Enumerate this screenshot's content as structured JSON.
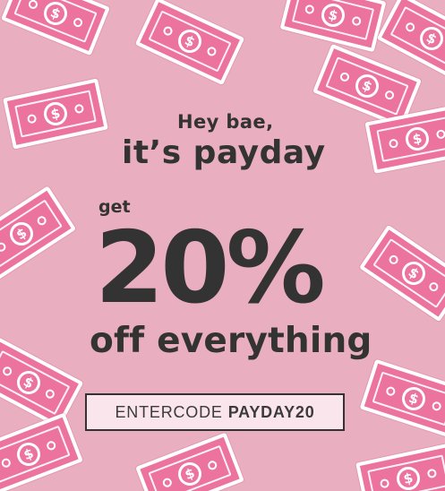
{
  "promo": {
    "line1": "Hey bae,",
    "line2": "it’s payday",
    "line3": "get",
    "discount": "20%",
    "line5": "off everything",
    "code_prefix": "ENTERCODE",
    "code": "PAYDAY20"
  },
  "bill_symbol": "$",
  "colors": {
    "background": "#e9aebf",
    "bill": "#ec739d",
    "text": "#333333",
    "code_box": "#fbe5ec"
  },
  "icons": {
    "bill": "dollar-bill-icon"
  }
}
